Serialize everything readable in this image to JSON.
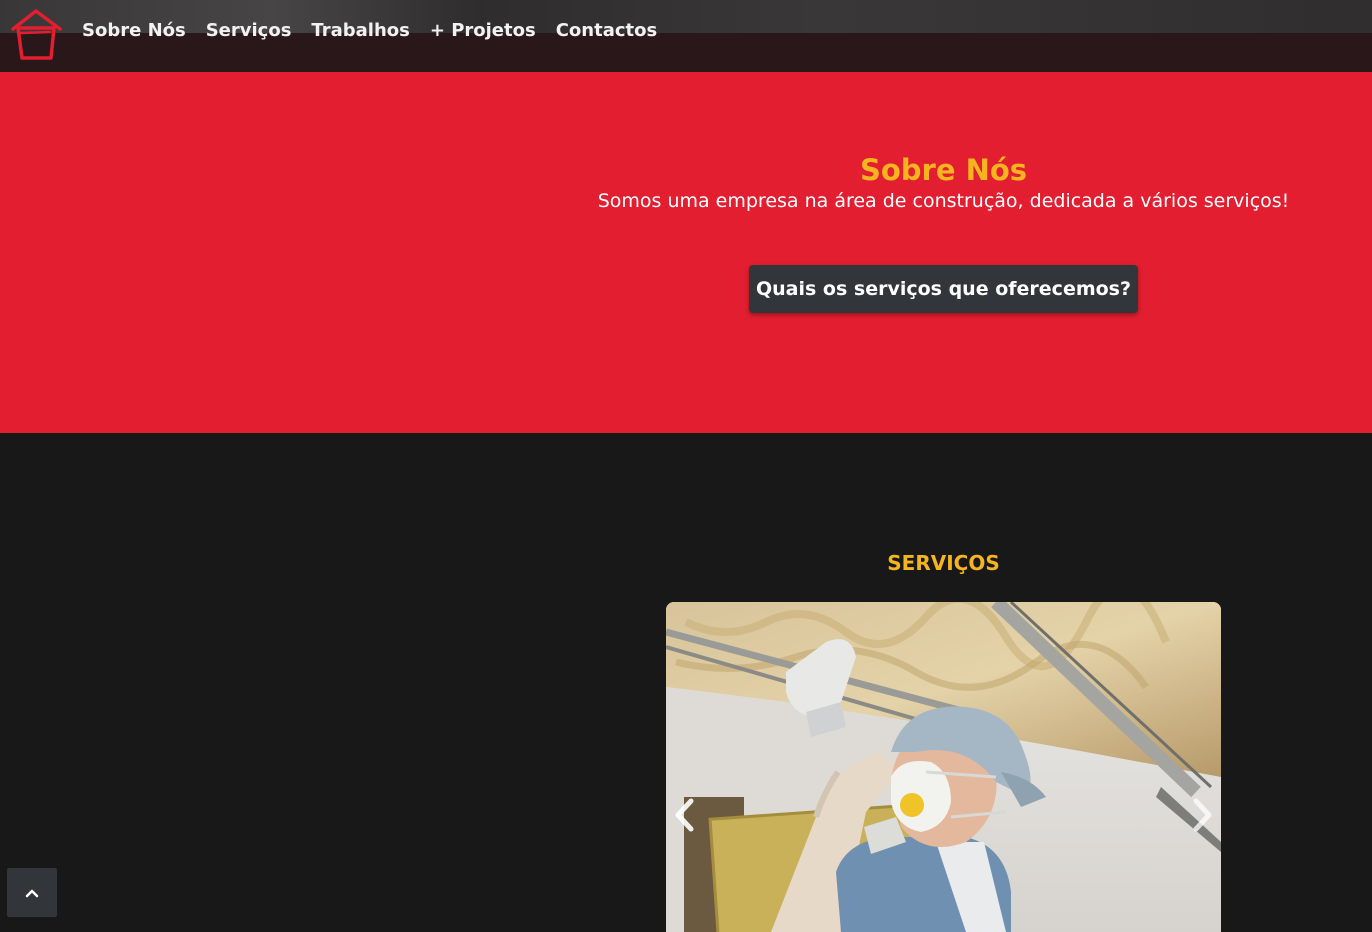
{
  "nav": {
    "logo_icon": "house-logo-icon",
    "links": [
      {
        "label": "Sobre Nós"
      },
      {
        "label": "Serviços"
      },
      {
        "label": "Trabalhos"
      },
      {
        "label": "+ Projetos"
      },
      {
        "label": "Contactos"
      }
    ]
  },
  "about": {
    "title": "Sobre Nós",
    "text": "Somos uma empresa na área de construção, dedicada a vários serviços!",
    "button_label": "Quais os serviços que oferecemos?"
  },
  "services": {
    "title": "SERVIÇOS",
    "carousel": {
      "image_icon": "worker-insulation-photo",
      "prev_icon": "chevron-left-icon",
      "next_icon": "chevron-right-icon"
    }
  },
  "scroll_top_icon": "chevron-up-icon",
  "colors": {
    "accent_red": "#e31e30",
    "accent_yellow": "#f6b41e",
    "dark_bg": "#181819",
    "button_bg": "#32363a"
  }
}
